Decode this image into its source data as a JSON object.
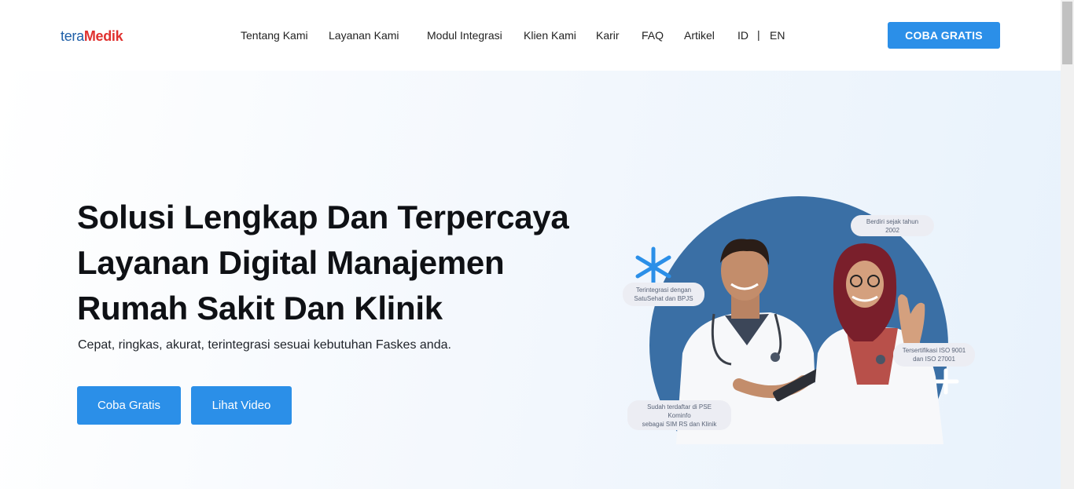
{
  "logo": {
    "part1": "tera",
    "part2": "Medik"
  },
  "nav": {
    "items": [
      "Tentang Kami",
      "Layanan Kami",
      "Modul Integrasi",
      "Klien Kami",
      "Karir",
      "FAQ",
      "Artikel"
    ],
    "lang_id": "ID",
    "lang_sep": "|",
    "lang_en": "EN"
  },
  "header_cta": "COBA GRATIS",
  "hero": {
    "headline_lines": [
      "Solusi Lengkap Dan Terpercaya",
      "Layanan Digital Manajemen",
      "Rumah Sakit Dan Klinik"
    ],
    "subtitle": "Cepat, ringkas, akurat, terintegrasi sesuai kebutuhan Faskes anda.",
    "btn_trial": "Coba Gratis",
    "btn_video": "Lihat Video"
  },
  "badges": {
    "founded": "Berdiri sejak tahun 2002",
    "integration_l1": "Terintegrasi dengan",
    "integration_l2": "SatuSehat dan BPJS",
    "iso_l1": "Tersertifikasi ISO 9001",
    "iso_l2": "dan ISO 27001",
    "pse_l1": "Sudah terdaftar di PSE Kominfo",
    "pse_l2": "sebagai SIM RS dan Klinik"
  },
  "colors": {
    "primary": "#2b8fe8",
    "logo_blue": "#1f5fa8",
    "logo_red": "#e0312f",
    "circle": "#3a6fa5"
  }
}
